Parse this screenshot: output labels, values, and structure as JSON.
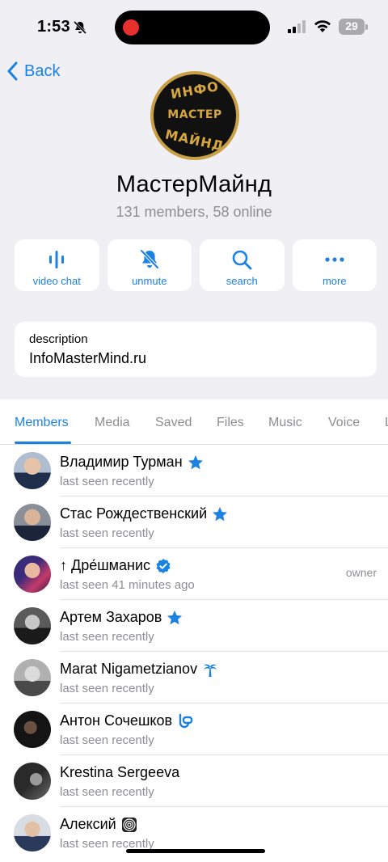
{
  "status_bar": {
    "time": "1:53",
    "battery": "29"
  },
  "nav": {
    "back_label": "Back"
  },
  "group": {
    "logo_top": "ИНФО",
    "logo_mid": "МАСТЕР",
    "logo_bot": "МАЙНД",
    "name": "МастерМайнд",
    "subtitle": "131 members, 58 online"
  },
  "actions": [
    {
      "label": "video chat",
      "icon": "waveform-icon"
    },
    {
      "label": "unmute",
      "icon": "bell-slash-icon"
    },
    {
      "label": "search",
      "icon": "magnifier-icon"
    },
    {
      "label": "more",
      "icon": "ellipsis-icon"
    }
  ],
  "description": {
    "label": "description",
    "value": "InfoMasterMind.ru"
  },
  "tabs": [
    "Members",
    "Media",
    "Saved",
    "Files",
    "Music",
    "Voice",
    "L"
  ],
  "active_tab": "Members",
  "accent_color": "#1a82e2",
  "members": [
    {
      "name": "Владимир Турман",
      "status": "last seen recently",
      "role": "",
      "badge": "star-icon"
    },
    {
      "name": "Стас Рождественский",
      "status": "last seen recently",
      "role": "",
      "badge": "star-icon"
    },
    {
      "name": "↑ Дре́шманис",
      "status": "last seen 41 minutes ago",
      "role": "owner",
      "badge": "verified-icon"
    },
    {
      "name": "Артем Захаров",
      "status": "last seen recently",
      "role": "",
      "badge": "star-icon"
    },
    {
      "name": "Marat Nigametzianov",
      "status": "last seen recently",
      "role": "",
      "badge": "palm-tree-icon"
    },
    {
      "name": "Антон Сочешков",
      "status": "last seen recently",
      "role": "",
      "badge": "snorkel-icon"
    },
    {
      "name": "Krestina Sergeeva",
      "status": "last seen recently",
      "role": "",
      "badge": ""
    },
    {
      "name": "Алексий",
      "status": "last seen recently",
      "role": "",
      "badge": "hypno-icon"
    }
  ]
}
